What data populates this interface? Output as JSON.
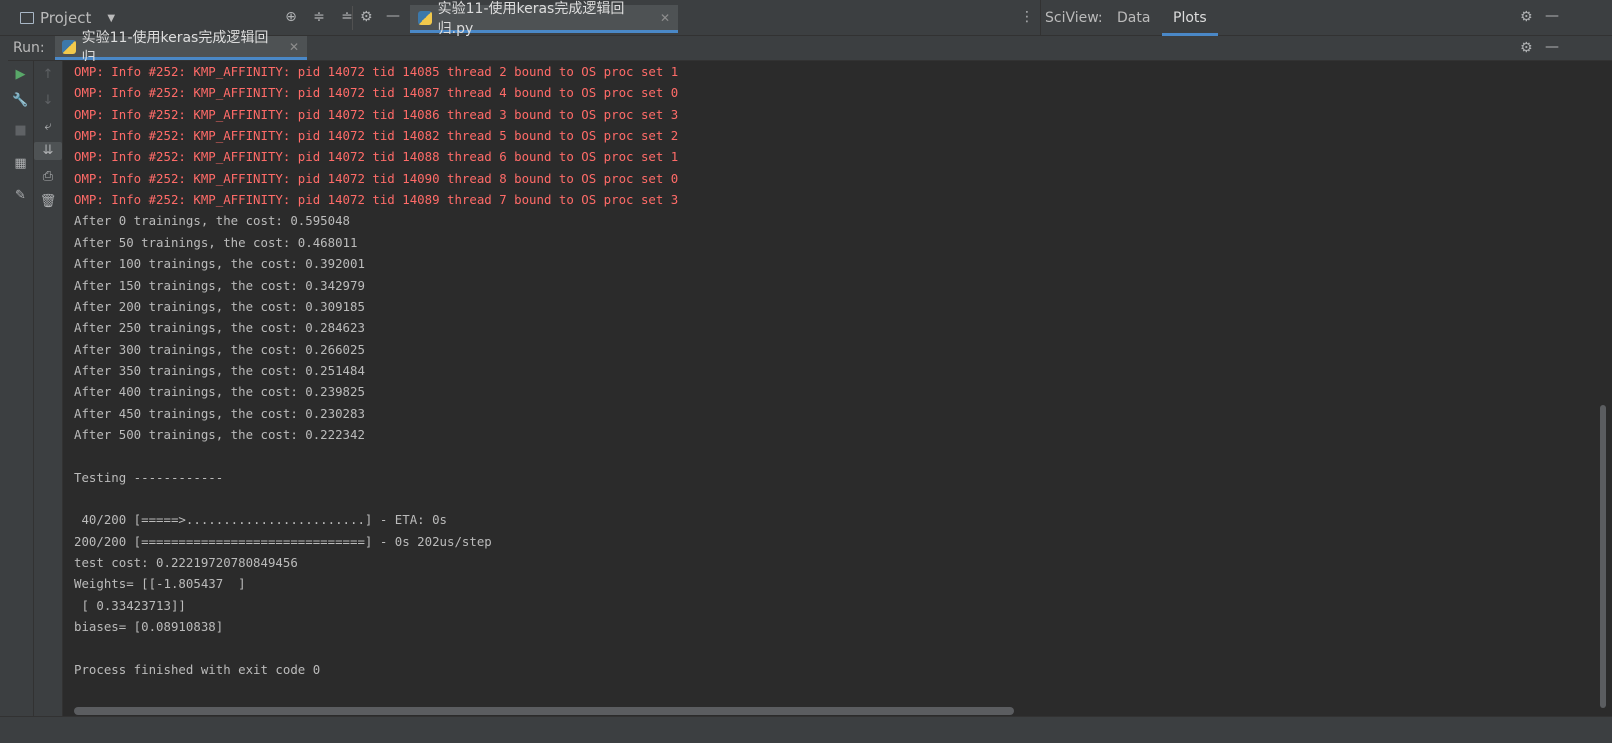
{
  "topbar": {
    "project_label": "Project",
    "editor_tab_label": "实验11-使用keras完成逻辑回归.py",
    "sciview_label": "SciView:",
    "sciview_tabs": [
      "Data",
      "Plots"
    ],
    "active_sciview_tab": "Plots"
  },
  "run": {
    "label": "Run:",
    "tab_label": "实验11-使用keras完成逻辑回归"
  },
  "console": {
    "lines": [
      {
        "text": "OMP: Info #252: KMP_AFFINITY: pid 14072 tid 14085 thread 2 bound to OS proc set 1",
        "type": "stderr"
      },
      {
        "text": "OMP: Info #252: KMP_AFFINITY: pid 14072 tid 14087 thread 4 bound to OS proc set 0",
        "type": "stderr"
      },
      {
        "text": "OMP: Info #252: KMP_AFFINITY: pid 14072 tid 14086 thread 3 bound to OS proc set 3",
        "type": "stderr"
      },
      {
        "text": "OMP: Info #252: KMP_AFFINITY: pid 14072 tid 14082 thread 5 bound to OS proc set 2",
        "type": "stderr"
      },
      {
        "text": "OMP: Info #252: KMP_AFFINITY: pid 14072 tid 14088 thread 6 bound to OS proc set 1",
        "type": "stderr"
      },
      {
        "text": "OMP: Info #252: KMP_AFFINITY: pid 14072 tid 14090 thread 8 bound to OS proc set 0",
        "type": "stderr"
      },
      {
        "text": "OMP: Info #252: KMP_AFFINITY: pid 14072 tid 14089 thread 7 bound to OS proc set 3",
        "type": "stderr"
      },
      {
        "text": "After 0 trainings, the cost: 0.595048",
        "type": "stdout"
      },
      {
        "text": "After 50 trainings, the cost: 0.468011",
        "type": "stdout"
      },
      {
        "text": "After 100 trainings, the cost: 0.392001",
        "type": "stdout"
      },
      {
        "text": "After 150 trainings, the cost: 0.342979",
        "type": "stdout"
      },
      {
        "text": "After 200 trainings, the cost: 0.309185",
        "type": "stdout"
      },
      {
        "text": "After 250 trainings, the cost: 0.284623",
        "type": "stdout"
      },
      {
        "text": "After 300 trainings, the cost: 0.266025",
        "type": "stdout"
      },
      {
        "text": "After 350 trainings, the cost: 0.251484",
        "type": "stdout"
      },
      {
        "text": "After 400 trainings, the cost: 0.239825",
        "type": "stdout"
      },
      {
        "text": "After 450 trainings, the cost: 0.230283",
        "type": "stdout"
      },
      {
        "text": "After 500 trainings, the cost: 0.222342",
        "type": "stdout"
      },
      {
        "text": "",
        "type": "stdout"
      },
      {
        "text": "Testing ------------",
        "type": "stdout"
      },
      {
        "text": "",
        "type": "stdout"
      },
      {
        "text": " 40/200 [=====>........................] - ETA: 0s",
        "type": "stdout"
      },
      {
        "text": "200/200 [==============================] - 0s 202us/step",
        "type": "stdout"
      },
      {
        "text": "test cost: 0.22219720780849456",
        "type": "stdout"
      },
      {
        "text": "Weights= [[-1.805437  ]",
        "type": "stdout"
      },
      {
        "text": " [ 0.33423713]]",
        "type": "stdout"
      },
      {
        "text": "biases= [0.08910838]",
        "type": "stdout"
      },
      {
        "text": "",
        "type": "stdout"
      },
      {
        "text": "Process finished with exit code 0",
        "type": "stdout"
      }
    ]
  },
  "colors": {
    "stderr": "#ff6b68",
    "stdout": "#bbbbbb",
    "accent": "#4a88c7",
    "run_green": "#59a869"
  }
}
